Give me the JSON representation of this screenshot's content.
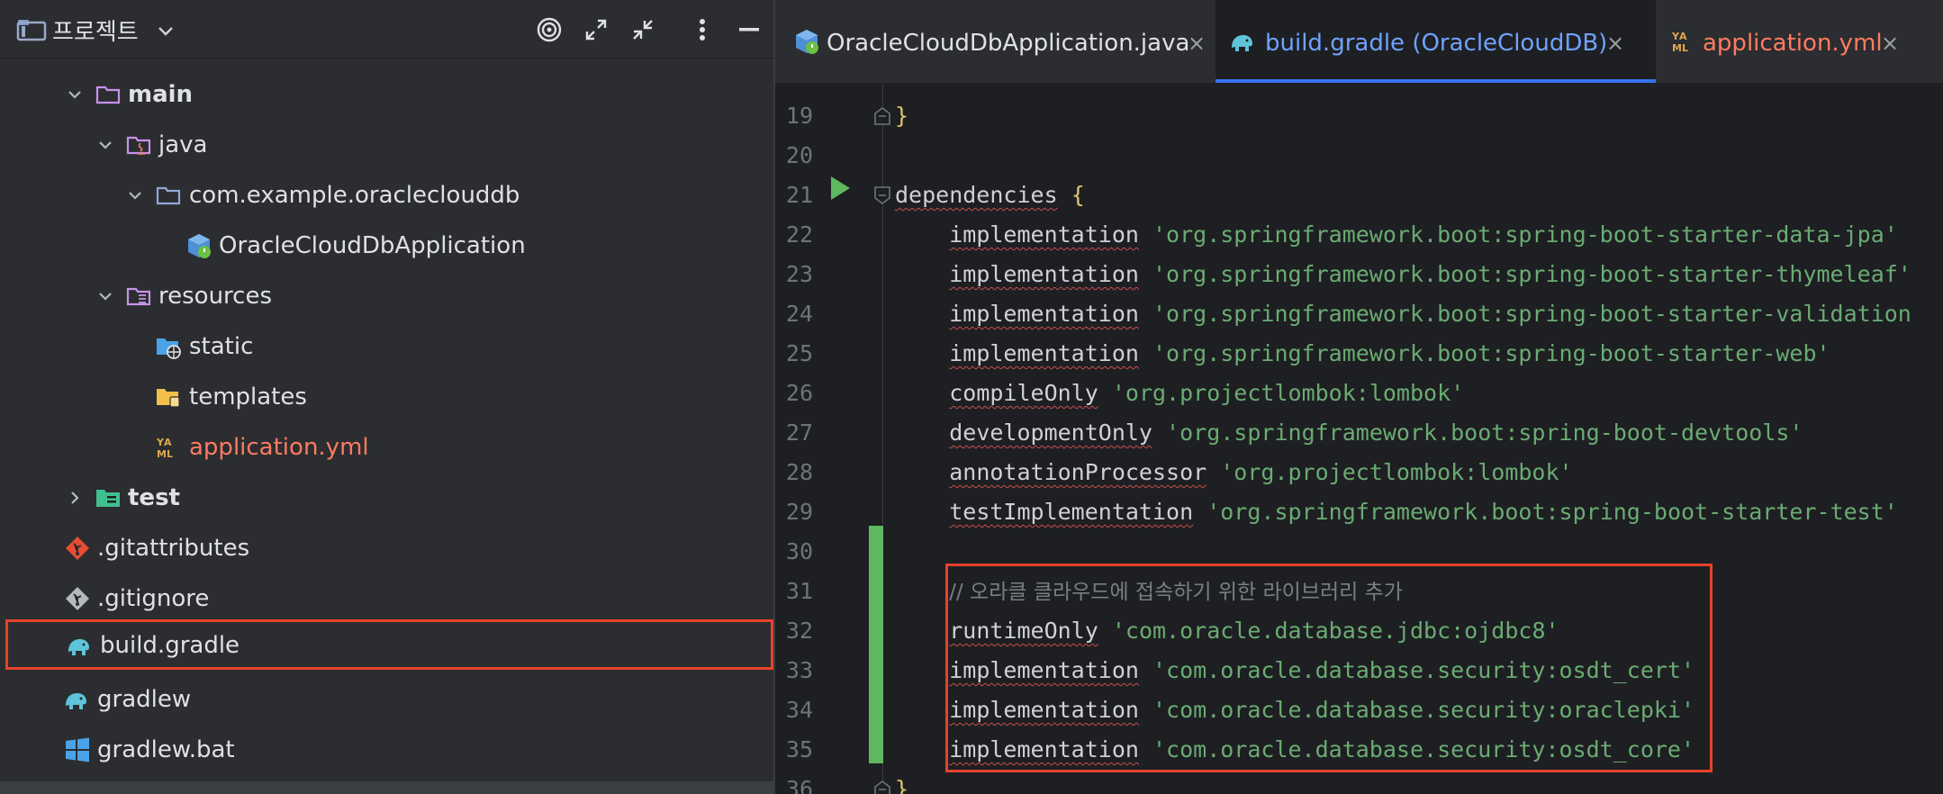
{
  "project_panel": {
    "title": "프로젝트",
    "tree": [
      {
        "label": "main",
        "type": "folder",
        "expanded": true
      },
      {
        "label": "java",
        "type": "java-source-folder",
        "expanded": true
      },
      {
        "label": "com.example.oracleclouddb",
        "type": "package",
        "expanded": true
      },
      {
        "label": "OracleCloudDbApplication",
        "type": "spring-boot-class"
      },
      {
        "label": "resources",
        "type": "resources-folder",
        "expanded": true
      },
      {
        "label": "static",
        "type": "web-folder"
      },
      {
        "label": "templates",
        "type": "templates-folder"
      },
      {
        "label": "application.yml",
        "type": "yaml-file",
        "modified": true
      },
      {
        "label": "test",
        "type": "test-folder",
        "expanded": false
      },
      {
        "label": ".gitattributes",
        "type": "git-file"
      },
      {
        "label": ".gitignore",
        "type": "gitignore-file"
      },
      {
        "label": "build.gradle",
        "type": "gradle-file",
        "highlighted": true
      },
      {
        "label": "gradlew",
        "type": "gradle-file"
      },
      {
        "label": "gradlew.bat",
        "type": "windows-batch-file"
      }
    ]
  },
  "editor": {
    "tabs": [
      {
        "label": "OracleCloudDbApplication.java",
        "active": false
      },
      {
        "label": "build.gradle (OracleCloudDB)",
        "active": true
      },
      {
        "label": "application.yml",
        "active": false,
        "modified": true
      }
    ],
    "close_glyph": "×",
    "lines": [
      {
        "n": "19",
        "tokens": [
          {
            "t": "}",
            "c": "brace"
          }
        ]
      },
      {
        "n": "20",
        "tokens": []
      },
      {
        "n": "21",
        "tokens": [
          {
            "t": "dependencies",
            "c": "kw"
          },
          {
            "t": " ",
            "c": "plain"
          },
          {
            "t": "{",
            "c": "brace"
          }
        ]
      },
      {
        "n": "22",
        "tokens": [
          {
            "t": "    ",
            "c": "plain"
          },
          {
            "t": "implementation",
            "c": "kw"
          },
          {
            "t": " 'org.springframework.boot:spring-boot-starter-data-jpa'",
            "c": "str"
          }
        ]
      },
      {
        "n": "23",
        "tokens": [
          {
            "t": "    ",
            "c": "plain"
          },
          {
            "t": "implementation",
            "c": "kw"
          },
          {
            "t": " 'org.springframework.boot:spring-boot-starter-thymeleaf'",
            "c": "str"
          }
        ]
      },
      {
        "n": "24",
        "tokens": [
          {
            "t": "    ",
            "c": "plain"
          },
          {
            "t": "implementation",
            "c": "kw"
          },
          {
            "t": " 'org.springframework.boot:spring-boot-starter-validation",
            "c": "str"
          }
        ]
      },
      {
        "n": "25",
        "tokens": [
          {
            "t": "    ",
            "c": "plain"
          },
          {
            "t": "implementation",
            "c": "kw"
          },
          {
            "t": " 'org.springframework.boot:spring-boot-starter-web'",
            "c": "str"
          }
        ]
      },
      {
        "n": "26",
        "tokens": [
          {
            "t": "    ",
            "c": "plain"
          },
          {
            "t": "compileOnly",
            "c": "kw"
          },
          {
            "t": " 'org.projectlombok:lombok'",
            "c": "str"
          }
        ]
      },
      {
        "n": "27",
        "tokens": [
          {
            "t": "    ",
            "c": "plain"
          },
          {
            "t": "developmentOnly",
            "c": "kw"
          },
          {
            "t": " 'org.springframework.boot:spring-boot-devtools'",
            "c": "str"
          }
        ]
      },
      {
        "n": "28",
        "tokens": [
          {
            "t": "    ",
            "c": "plain"
          },
          {
            "t": "annotationProcessor",
            "c": "kw"
          },
          {
            "t": " 'org.projectlombok:lombok'",
            "c": "str"
          }
        ]
      },
      {
        "n": "29",
        "tokens": [
          {
            "t": "    ",
            "c": "plain"
          },
          {
            "t": "testImplementation",
            "c": "kw"
          },
          {
            "t": " 'org.springframework.boot:spring-boot-starter-test'",
            "c": "str"
          }
        ]
      },
      {
        "n": "30",
        "tokens": []
      },
      {
        "n": "31",
        "tokens": [
          {
            "t": "    ",
            "c": "plain"
          },
          {
            "t": "// 오라클 클라우드에 접속하기 위한 라이브러리 추가",
            "c": "cmt"
          }
        ]
      },
      {
        "n": "32",
        "tokens": [
          {
            "t": "    ",
            "c": "plain"
          },
          {
            "t": "runtimeOnly",
            "c": "kw"
          },
          {
            "t": " 'com.oracle.database.jdbc:ojdbc8'",
            "c": "str"
          }
        ]
      },
      {
        "n": "33",
        "tokens": [
          {
            "t": "    ",
            "c": "plain"
          },
          {
            "t": "implementation",
            "c": "kw"
          },
          {
            "t": " 'com.oracle.database.security:osdt_cert'",
            "c": "str"
          }
        ]
      },
      {
        "n": "34",
        "tokens": [
          {
            "t": "    ",
            "c": "plain"
          },
          {
            "t": "implementation",
            "c": "kw"
          },
          {
            "t": " 'com.oracle.database.security:oraclepki'",
            "c": "str"
          }
        ]
      },
      {
        "n": "35",
        "tokens": [
          {
            "t": "    ",
            "c": "plain"
          },
          {
            "t": "implementation",
            "c": "kw"
          },
          {
            "t": " 'com.oracle.database.security:osdt_core'",
            "c": "str"
          }
        ]
      },
      {
        "n": "36",
        "tokens": [
          {
            "t": "}",
            "c": "brace"
          }
        ]
      }
    ]
  },
  "colors": {
    "accent": "#3574f0",
    "highlight_border": "#e8412c",
    "string": "#6aab73",
    "added_line_marker": "#5fb760",
    "modified_file": "#ff7b61"
  }
}
